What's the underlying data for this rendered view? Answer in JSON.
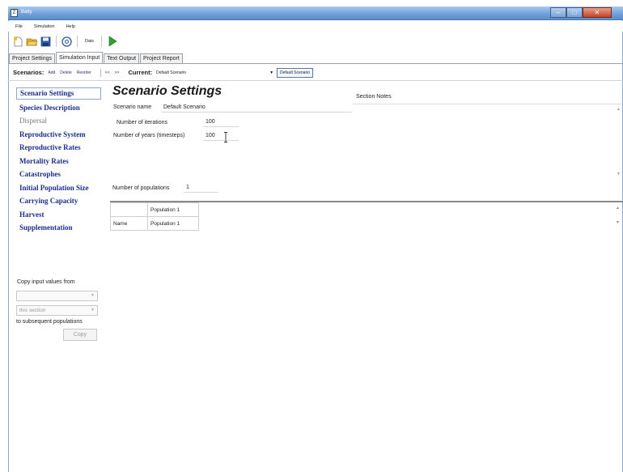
{
  "window": {
    "title": "Batty",
    "app_icon_letter": "Z"
  },
  "menu": [
    "File",
    "Simulation",
    "Help"
  ],
  "toolbar": {
    "run_text_label": "Dais"
  },
  "tabs": [
    "Project Settings",
    "Simulation Input",
    "Text Output",
    "Project Report"
  ],
  "scenarios": {
    "label": "Scenarios:",
    "actions": [
      "Add",
      "Delete",
      "Reorder"
    ],
    "nav_prev": "<<",
    "nav_next": ">>",
    "current_label": "Current:",
    "current_value": "Default Scenario",
    "select_button": "Default Scenario"
  },
  "nav": {
    "items": [
      "Scenario Settings",
      "Species Description",
      "Dispersal",
      "Reproductive System",
      "Reproductive Rates",
      "Mortality Rates",
      "Catastrophes",
      "Initial Population Size",
      "Carrying Capacity",
      "Harvest",
      "Supplementation"
    ]
  },
  "copy_panel": {
    "label": "Copy input values from",
    "source_value": "",
    "section_value": "this section",
    "subsequent_label": "to subsequent populations",
    "copy_button": "Copy"
  },
  "main": {
    "heading": "Scenario Settings",
    "scenario_name_label": "Scenario name",
    "scenario_name_value": "Default Scenario",
    "iterations_label": "Number of iterations",
    "iterations_value": "100",
    "years_label": "Number of years (timesteps)",
    "years_value": "100",
    "populations_label": "Number of populations",
    "populations_value": "1",
    "section_notes_label": "Section Notes",
    "grid": {
      "header": [
        "",
        "Population 1"
      ],
      "rows": [
        [
          "Name",
          "Population 1"
        ]
      ]
    }
  },
  "colors": {
    "nav_link": "#1c2f8c",
    "titlebar": "#6f9fd8",
    "close_button": "#c2442a"
  }
}
